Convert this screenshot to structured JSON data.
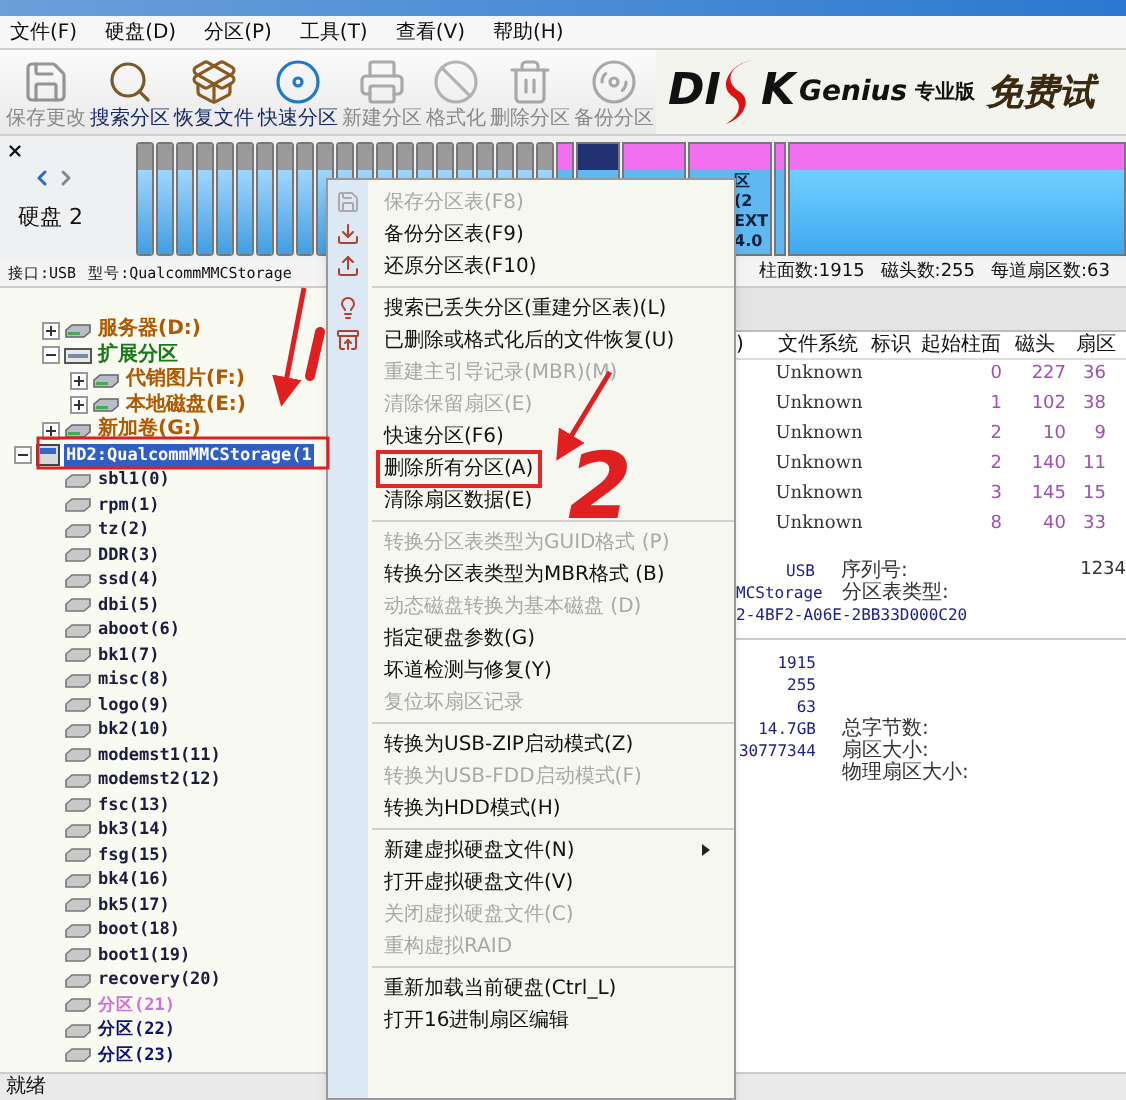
{
  "menu_bar": [
    "文件(F)",
    "硬盘(D)",
    "分区(P)",
    "工具(T)",
    "查看(V)",
    "帮助(H)"
  ],
  "toolbar": [
    {
      "label": "保存更改",
      "kind": "save",
      "disabled": true
    },
    {
      "label": "搜索分区",
      "kind": "search",
      "disabled": false
    },
    {
      "label": "恢复文件",
      "kind": "recover",
      "disabled": false
    },
    {
      "label": "快速分区",
      "kind": "quick",
      "disabled": false
    },
    {
      "label": "新建分区",
      "kind": "new",
      "disabled": true
    },
    {
      "label": "格式化",
      "kind": "format",
      "disabled": true
    },
    {
      "label": "删除分区",
      "kind": "delete",
      "disabled": true
    },
    {
      "label": "备份分区",
      "kind": "backup",
      "disabled": true
    }
  ],
  "logo": {
    "part_a": "DI",
    "part_b": "K",
    "part_c": "Genius",
    "edition": "专业版",
    "slogan": "免费试"
  },
  "disk_bar": {
    "label": "硬盘 2",
    "segment_lines": [
      "区(2",
      "EXT",
      "4.0"
    ]
  },
  "disk_info": {
    "left": [
      "接口:USB",
      "型号:QualcommMMCStorage"
    ],
    "right": [
      "柱面数:1915",
      "磁头数:255",
      "每道扇区数:63"
    ]
  },
  "tree": {
    "continued": [
      {
        "label": "服务器(D:)",
        "kind": "volume",
        "expanded": false,
        "selected": false,
        "color": "#b05a00"
      },
      {
        "label": "扩展分区",
        "kind": "extended",
        "expanded": true,
        "selected": false,
        "color": "#1a7a1a",
        "children": [
          {
            "label": "代销图片(F:)",
            "kind": "volume",
            "expanded": false,
            "selected": false,
            "color": "#b05a00"
          },
          {
            "label": "本地磁盘(E:)",
            "kind": "volume",
            "expanded": false,
            "selected": false,
            "color": "#b05a00"
          }
        ]
      },
      {
        "label": "新加卷(G:)",
        "kind": "volume",
        "expanded": false,
        "selected": false,
        "color": "#b05a00"
      }
    ],
    "nodes": [
      {
        "label": "HD2:QualcommMMCStorage(1",
        "kind": "disk",
        "expanded": true,
        "selected": true,
        "children": [
          {
            "label": "sbl1(0)",
            "kind": "partition",
            "selected": false,
            "color": "#1c1c3c"
          },
          {
            "label": "rpm(1)",
            "kind": "partition",
            "selected": false,
            "color": "#1c1c3c"
          },
          {
            "label": "tz(2)",
            "kind": "partition",
            "selected": false,
            "color": "#1c1c3c"
          },
          {
            "label": "DDR(3)",
            "kind": "partition",
            "selected": false,
            "color": "#1c1c3c"
          },
          {
            "label": "ssd(4)",
            "kind": "partition",
            "selected": false,
            "color": "#1c1c3c"
          },
          {
            "label": "dbi(5)",
            "kind": "partition",
            "selected": false,
            "color": "#1c1c3c"
          },
          {
            "label": "aboot(6)",
            "kind": "partition",
            "selected": false,
            "color": "#1c1c3c"
          },
          {
            "label": "bk1(7)",
            "kind": "partition",
            "selected": false,
            "color": "#1c1c3c"
          },
          {
            "label": "misc(8)",
            "kind": "partition",
            "selected": false,
            "color": "#1c1c3c"
          },
          {
            "label": "logo(9)",
            "kind": "partition",
            "selected": false,
            "color": "#1c1c3c"
          },
          {
            "label": "bk2(10)",
            "kind": "partition",
            "selected": false,
            "color": "#1c1c3c"
          },
          {
            "label": "modemst1(11)",
            "kind": "partition",
            "selected": false,
            "color": "#1c1c3c"
          },
          {
            "label": "modemst2(12)",
            "kind": "partition",
            "selected": false,
            "color": "#1c1c3c"
          },
          {
            "label": "fsc(13)",
            "kind": "partition",
            "selected": false,
            "color": "#1c1c3c"
          },
          {
            "label": "bk3(14)",
            "kind": "partition",
            "selected": false,
            "color": "#1c1c3c"
          },
          {
            "label": "fsg(15)",
            "kind": "partition",
            "selected": false,
            "color": "#1c1c3c"
          },
          {
            "label": "bk4(16)",
            "kind": "partition",
            "selected": false,
            "color": "#1c1c3c"
          },
          {
            "label": "bk5(17)",
            "kind": "partition",
            "selected": false,
            "color": "#1c1c3c"
          },
          {
            "label": "boot(18)",
            "kind": "partition",
            "selected": false,
            "color": "#1c1c3c"
          },
          {
            "label": "boot1(19)",
            "kind": "partition",
            "selected": false,
            "color": "#1c1c3c"
          },
          {
            "label": "recovery(20)",
            "kind": "partition",
            "selected": false,
            "color": "#1c1c3c"
          },
          {
            "label": "分区(21)",
            "kind": "partition",
            "selected": false,
            "color": "#d070d8"
          },
          {
            "label": "分区(22)",
            "kind": "partition",
            "selected": false,
            "color": "#101070"
          },
          {
            "label": "分区(23)",
            "kind": "partition",
            "selected": false,
            "color": "#101070"
          }
        ]
      }
    ]
  },
  "table": {
    "columns": [
      ")",
      "文件系统",
      "标识",
      "起始柱面",
      "磁头",
      "扇区"
    ],
    "rows": [
      {
        "file_system": "Unknown",
        "start_cylinder": "0",
        "heads": "227",
        "sectors": "36"
      },
      {
        "file_system": "Unknown",
        "start_cylinder": "1",
        "heads": "102",
        "sectors": "38"
      },
      {
        "file_system": "Unknown",
        "start_cylinder": "2",
        "heads": "10",
        "sectors": "9"
      },
      {
        "file_system": "Unknown",
        "start_cylinder": "2",
        "heads": "140",
        "sectors": "11"
      },
      {
        "file_system": "Unknown",
        "start_cylinder": "3",
        "heads": "145",
        "sectors": "15"
      },
      {
        "file_system": "Unknown",
        "start_cylinder": "8",
        "heads": "40",
        "sectors": "33"
      }
    ]
  },
  "details": {
    "top": [
      {
        "value": "USB",
        "label": "序列号:",
        "extra": "1234"
      },
      {
        "value": "MCStorage",
        "label": "分区表类型:"
      },
      {
        "value": "2-4BF2-A06E-2BB33D000C20"
      }
    ],
    "bottom": [
      {
        "value": "1915"
      },
      {
        "value": "255"
      },
      {
        "value": "63"
      },
      {
        "value": "14.7GB",
        "label": "总字节数:"
      },
      {
        "value": "30777344",
        "label": "扇区大小:"
      },
      {
        "label": "物理扇区大小:"
      }
    ]
  },
  "context_menu": [
    {
      "kind": "item",
      "label": "保存分区表(F8)",
      "disabled": true,
      "marked": false,
      "submenu": false
    },
    {
      "kind": "item",
      "label": "备份分区表(F9)",
      "disabled": false,
      "marked": false,
      "submenu": false
    },
    {
      "kind": "item",
      "label": "还原分区表(F10)",
      "disabled": false,
      "marked": false,
      "submenu": false
    },
    {
      "kind": "separator"
    },
    {
      "kind": "item",
      "label": "搜索已丢失分区(重建分区表)(L)",
      "disabled": false,
      "marked": false,
      "submenu": false
    },
    {
      "kind": "item",
      "label": "已删除或格式化后的文件恢复(U)",
      "disabled": false,
      "marked": false,
      "submenu": false
    },
    {
      "kind": "item",
      "label": "重建主引导记录(MBR)(M)",
      "disabled": true,
      "marked": false,
      "submenu": false
    },
    {
      "kind": "item",
      "label": "清除保留扇区(E)",
      "disabled": true,
      "marked": false,
      "submenu": false
    },
    {
      "kind": "item",
      "label": "快速分区(F6)",
      "disabled": false,
      "marked": false,
      "submenu": false
    },
    {
      "kind": "item",
      "label": "删除所有分区(A)",
      "disabled": false,
      "marked": true,
      "submenu": false
    },
    {
      "kind": "item",
      "label": "清除扇区数据(E)",
      "disabled": false,
      "marked": false,
      "submenu": false
    },
    {
      "kind": "separator"
    },
    {
      "kind": "item",
      "label": "转换分区表类型为GUID格式 (P)",
      "disabled": true,
      "marked": false,
      "submenu": false
    },
    {
      "kind": "item",
      "label": "转换分区表类型为MBR格式 (B)",
      "disabled": false,
      "marked": false,
      "submenu": false
    },
    {
      "kind": "item",
      "label": "动态磁盘转换为基本磁盘 (D)",
      "disabled": true,
      "marked": false,
      "submenu": false
    },
    {
      "kind": "item",
      "label": "指定硬盘参数(G)",
      "disabled": false,
      "marked": false,
      "submenu": false
    },
    {
      "kind": "item",
      "label": "坏道检测与修复(Y)",
      "disabled": false,
      "marked": false,
      "submenu": false
    },
    {
      "kind": "item",
      "label": "复位坏扇区记录",
      "disabled": true,
      "marked": false,
      "submenu": false
    },
    {
      "kind": "separator"
    },
    {
      "kind": "item",
      "label": "转换为USB-ZIP启动模式(Z)",
      "disabled": false,
      "marked": false,
      "submenu": false
    },
    {
      "kind": "item",
      "label": "转换为USB-FDD启动模式(F)",
      "disabled": true,
      "marked": false,
      "submenu": false
    },
    {
      "kind": "item",
      "label": "转换为HDD模式(H)",
      "disabled": false,
      "marked": false,
      "submenu": false
    },
    {
      "kind": "separator"
    },
    {
      "kind": "item",
      "label": "新建虚拟硬盘文件(N)",
      "disabled": false,
      "marked": false,
      "submenu": true
    },
    {
      "kind": "item",
      "label": "打开虚拟硬盘文件(V)",
      "disabled": false,
      "marked": false,
      "submenu": false
    },
    {
      "kind": "item",
      "label": "关闭虚拟硬盘文件(C)",
      "disabled": true,
      "marked": false,
      "submenu": false
    },
    {
      "kind": "item",
      "label": "重构虚拟RAID",
      "disabled": true,
      "marked": false,
      "submenu": false
    },
    {
      "kind": "separator"
    },
    {
      "kind": "item",
      "label": "重新加载当前硬盘(Ctrl_L)",
      "disabled": false,
      "marked": false,
      "submenu": false
    },
    {
      "kind": "item",
      "label": "打开16进制扇区编辑",
      "disabled": false,
      "marked": false,
      "submenu": false
    }
  ],
  "annotation_label": "2",
  "status_bar": "就绪"
}
